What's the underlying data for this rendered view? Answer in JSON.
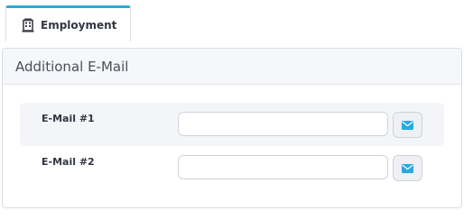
{
  "tabs": [
    {
      "label": "Employment",
      "icon": "building-icon",
      "active": true
    }
  ],
  "panel": {
    "title": "Additional E-Mail",
    "rows": [
      {
        "label": "E-Mail #1",
        "value": "",
        "button_icon": "mail-icon"
      },
      {
        "label": "E-Mail #2",
        "value": "",
        "button_icon": "mail-icon"
      }
    ]
  },
  "colors": {
    "tab_accent": "#29a8dd",
    "icon_blue": "#29a8dd",
    "row_shade": "#f4f5f8",
    "header_bg": "#f6f7f9"
  }
}
